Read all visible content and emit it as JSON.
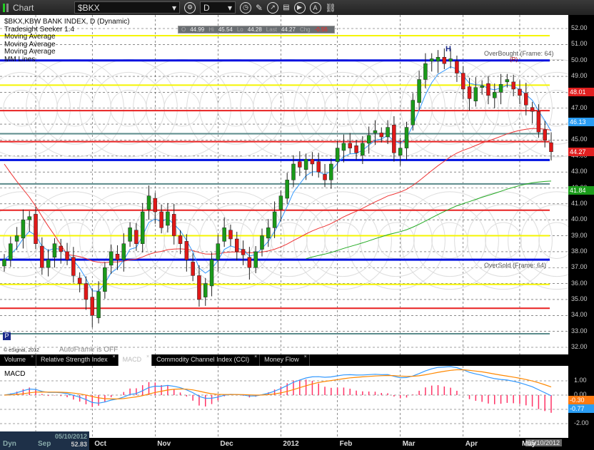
{
  "toolbar": {
    "title": "Chart",
    "symbol": "$BKX",
    "interval": "D"
  },
  "legend": {
    "title": "$BKX,KBW BANK INDEX, D (Dynamic)",
    "studies": [
      "Tradesight Seeker 1.4",
      "Moving Average",
      "Moving Average",
      "Moving Average",
      "MM Lines"
    ]
  },
  "quote": {
    "o_label": "O",
    "o": "44.99",
    "h_label": "Hi",
    "h": "45.54",
    "l_label": "Lo",
    "l": "44.28",
    "last_label": "Last",
    "last": "44.27",
    "chg_label": "Chg",
    "chg": "-0.56"
  },
  "annotations": {
    "overbought": "OverBought (Frame: 64)",
    "oversold": "OverSold (Frame: 64)",
    "head": "H",
    "r_mark": "(R)",
    "copyright": "© eSignal, 2012",
    "autoframe": "AutoFrame is OFF",
    "p_badge": "P"
  },
  "price_axis": [
    "52.00",
    "51.00",
    "50.00",
    "49.00",
    "48.00",
    "47.00",
    "46.00",
    "45.00",
    "44.00",
    "43.00",
    "42.00",
    "41.00",
    "40.00",
    "39.00",
    "38.00",
    "37.00",
    "36.00",
    "35.00",
    "34.00",
    "33.00",
    "32.00"
  ],
  "price_tags": [
    {
      "value": "48.01",
      "price": 48.01,
      "color": "#e02020"
    },
    {
      "value": "46.13",
      "price": 46.13,
      "color": "#2a9df4"
    },
    {
      "value": "44.27",
      "price": 44.27,
      "color": "#e02020"
    },
    {
      "value": "41.84",
      "price": 41.84,
      "color": "#1a9a1a"
    }
  ],
  "mm_lines": [
    {
      "price": 51.55,
      "color": "#f5f500"
    },
    {
      "price": 50.0,
      "color": "#0010e0"
    },
    {
      "price": 48.45,
      "color": "#f5f500"
    },
    {
      "price": 46.85,
      "color": "#e82020"
    },
    {
      "price": 45.4,
      "color": "#5a8a8a"
    },
    {
      "price": 44.9,
      "color": "#e82020"
    },
    {
      "price": 43.75,
      "color": "#0010e0"
    },
    {
      "price": 42.25,
      "color": "#5a8a8a"
    },
    {
      "price": 40.6,
      "color": "#e82020"
    },
    {
      "price": 39.0,
      "color": "#f5f500"
    },
    {
      "price": 37.5,
      "color": "#0010e0"
    },
    {
      "price": 35.95,
      "color": "#f5f500"
    },
    {
      "price": 34.45,
      "color": "#e82020"
    },
    {
      "price": 32.85,
      "color": "#5a8a8a"
    }
  ],
  "tabs": [
    {
      "label": "Volume"
    },
    {
      "label": "Relative Strength Index"
    },
    {
      "label": "MACD",
      "active": true
    },
    {
      "label": "Commodity Channel Index (CCI)"
    },
    {
      "label": "Money Flow"
    }
  ],
  "macd": {
    "title": "MACD",
    "axis": [
      "1.00",
      "0.00",
      "-1.00",
      "-2.00"
    ],
    "tags": [
      {
        "value": "-0.30",
        "color": "#ff7a10"
      },
      {
        "value": "-0.77",
        "color": "#2a9df4"
      }
    ]
  },
  "time_axis": {
    "months": [
      "Sep",
      "Oct",
      "Nov",
      "Dec",
      "2012",
      "Feb",
      "Mar",
      "Apr",
      "May"
    ],
    "month_index": [
      5,
      14,
      24,
      34,
      44,
      53,
      63,
      73,
      82
    ],
    "cursor_date": "05/10/2012",
    "cursor_price": "52.83",
    "dyn": "Dyn",
    "end_date": "05/10/2012"
  },
  "chart_data": {
    "type": "candlestick",
    "symbol": "$BKX",
    "ylim": [
      32,
      52.3
    ],
    "closes": [
      37.5,
      38.5,
      39,
      40,
      40.2,
      38.5,
      37,
      37.5,
      38.5,
      38,
      37.5,
      36.5,
      36,
      35,
      34,
      35.5,
      37,
      38,
      37.5,
      38.5,
      39.5,
      38.5,
      40.5,
      41.5,
      40.5,
      39.5,
      40.5,
      39,
      38.5,
      37.5,
      36.5,
      35,
      36,
      37.5,
      38.5,
      39.5,
      38.8,
      38,
      37.8,
      37,
      38,
      39,
      39.5,
      40.5,
      41.5,
      42.5,
      43.5,
      43.3,
      43.8,
      43.5,
      43,
      42.5,
      43.5,
      44.5,
      44.8,
      44.5,
      44.2,
      44.8,
      45.3,
      45.6,
      45.2,
      45.8,
      44.2,
      44.5,
      45.8,
      47.5,
      48.8,
      49.8,
      50.1,
      50.2,
      49.8,
      50.1,
      49.2,
      48.2,
      47.6,
      48.3,
      48.4,
      47.8,
      48,
      48.5,
      48.8,
      48.2,
      47.8,
      47.2,
      46.8,
      45.5,
      44.99,
      44.27
    ]
  }
}
